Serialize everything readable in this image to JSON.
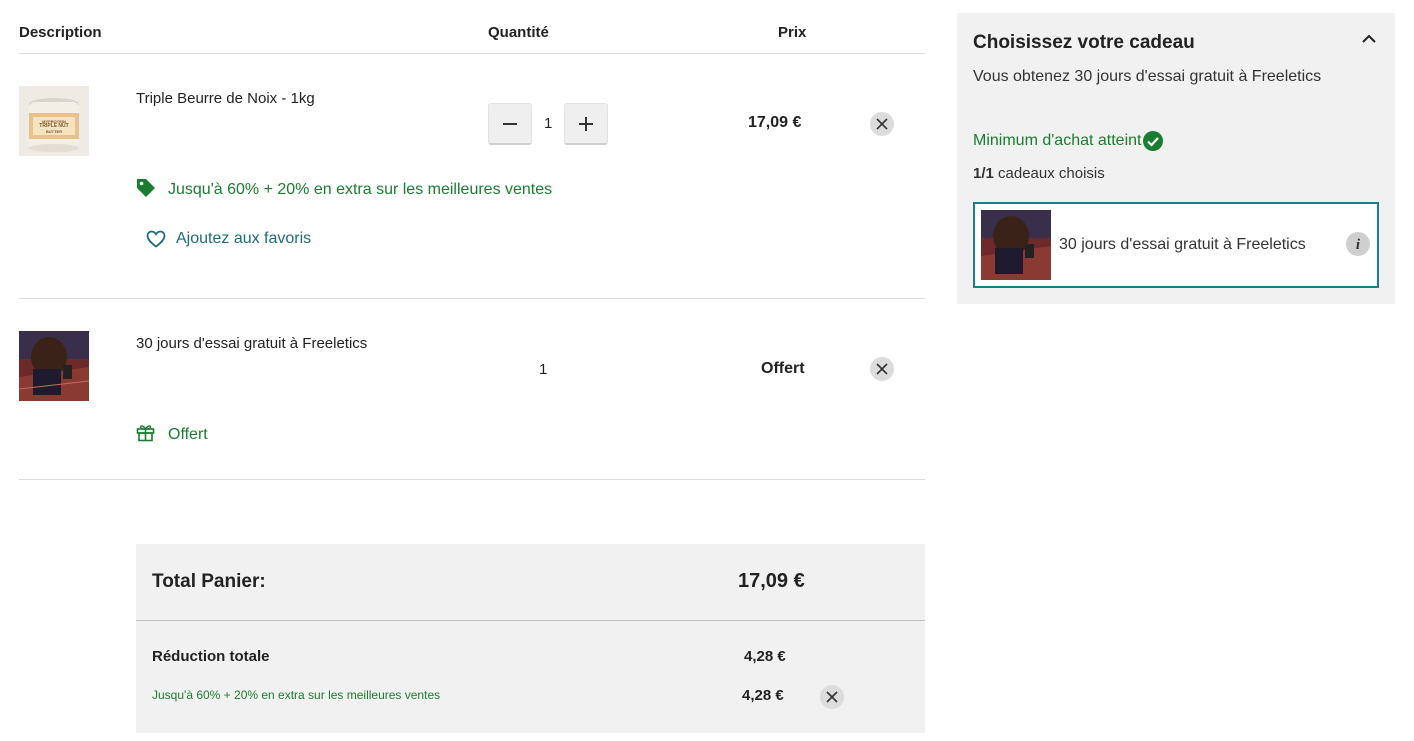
{
  "cart": {
    "headers": {
      "description": "Description",
      "quantity": "Quantité",
      "price": "Prix"
    },
    "items": [
      {
        "name": "Triple Beurre de Noix - 1kg",
        "quantity": "1",
        "price": "17,09 €",
        "thumb_label_top": "MYPROTEIN",
        "thumb_label_main": "TRIPLE NUT",
        "thumb_label_sub": "BUTTER",
        "promo": "Jusqu'à 60% + 20% en extra sur les meilleures ventes",
        "favorite": "Ajoutez aux favoris"
      },
      {
        "name": "30 jours d'essai gratuit à Freeletics",
        "quantity": "1",
        "price": "Offert",
        "badge": "Offert"
      }
    ]
  },
  "totals": {
    "total_label": "Total Panier:",
    "total_value": "17,09 €",
    "discount_label": "Réduction totale",
    "discount_value": "4,28 €",
    "promo_label": "Jusqu'à 60% + 20% en extra sur les meilleures ventes",
    "promo_value": "4,28 €"
  },
  "gift": {
    "title": "Choisissez votre cadeau",
    "subtitle": "Vous obtenez 30 jours d'essai gratuit à Freeletics",
    "status": "Minimum d'achat atteint",
    "count_bold": "1/1",
    "count_text": "cadeaux choisis",
    "card_label": "30 jours d'essai gratuit à Freeletics"
  },
  "colors": {
    "green": "#1a7d31",
    "teal": "#1a7f8a",
    "panel_bg": "#f1f1f1"
  },
  "icons": [
    "minus-icon",
    "plus-icon",
    "close-icon",
    "tag-icon",
    "heart-icon",
    "gift-icon",
    "check-circle-icon",
    "chevron-up-icon",
    "info-icon"
  ]
}
